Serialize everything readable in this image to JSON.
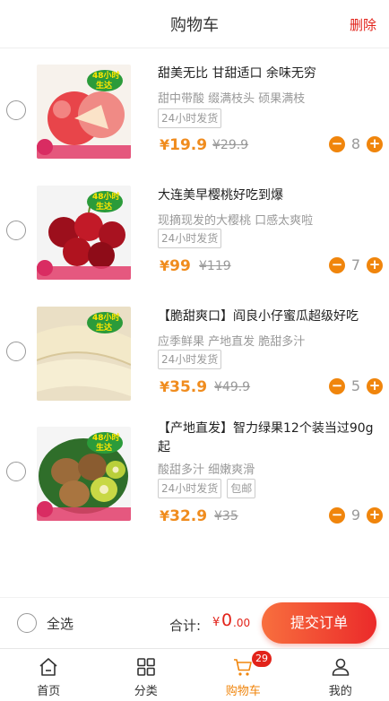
{
  "header": {
    "title": "购物车",
    "delete_label": "删除"
  },
  "items": [
    {
      "name": "甜美无比 甘甜适口 余味无穷",
      "subtitle": "甜中带酸 缀满枝头 硕果满枝",
      "tags": [
        "24小时发货"
      ],
      "price_symbol": "¥",
      "price": "19.9",
      "old_price": "¥29.9",
      "quantity": "8",
      "image_icon": "apple-image"
    },
    {
      "name": "大连美早樱桃好吃到爆",
      "subtitle": "现摘现发的大樱桃 口感太爽啦",
      "tags": [
        "24小时发货"
      ],
      "price_symbol": "¥",
      "price": "99",
      "old_price": "¥119",
      "quantity": "7",
      "image_icon": "cherry-image"
    },
    {
      "name": "【脆甜爽口】阎良小仔蜜瓜超级好吃",
      "subtitle": "应季鲜果 产地直发 脆甜多汁",
      "tags": [
        "24小时发货"
      ],
      "price_symbol": "¥",
      "price": "35.9",
      "old_price": "¥49.9",
      "quantity": "5",
      "image_icon": "melon-image"
    },
    {
      "name": "【产地直发】智力绿果12个装当过90g起",
      "subtitle": "酸甜多汁 细嫩爽滑",
      "tags": [
        "24小时发货",
        "包邮"
      ],
      "price_symbol": "¥",
      "price": "32.9",
      "old_price": "¥35",
      "quantity": "9",
      "image_icon": "kiwi-image"
    }
  ],
  "bottom": {
    "select_all_label": "全选",
    "total_label": "合计:",
    "total_symbol": "¥",
    "total_int": "0",
    "total_dec": ".00",
    "submit_label": "提交订单"
  },
  "tabbar": {
    "tabs": [
      {
        "label": "首页",
        "icon": "home-icon"
      },
      {
        "label": "分类",
        "icon": "category-icon"
      },
      {
        "label": "购物车",
        "icon": "cart-icon",
        "badge": "29"
      },
      {
        "label": "我的",
        "icon": "user-icon"
      }
    ]
  },
  "colors": {
    "accent": "#f0850c",
    "danger": "#e2231a"
  }
}
